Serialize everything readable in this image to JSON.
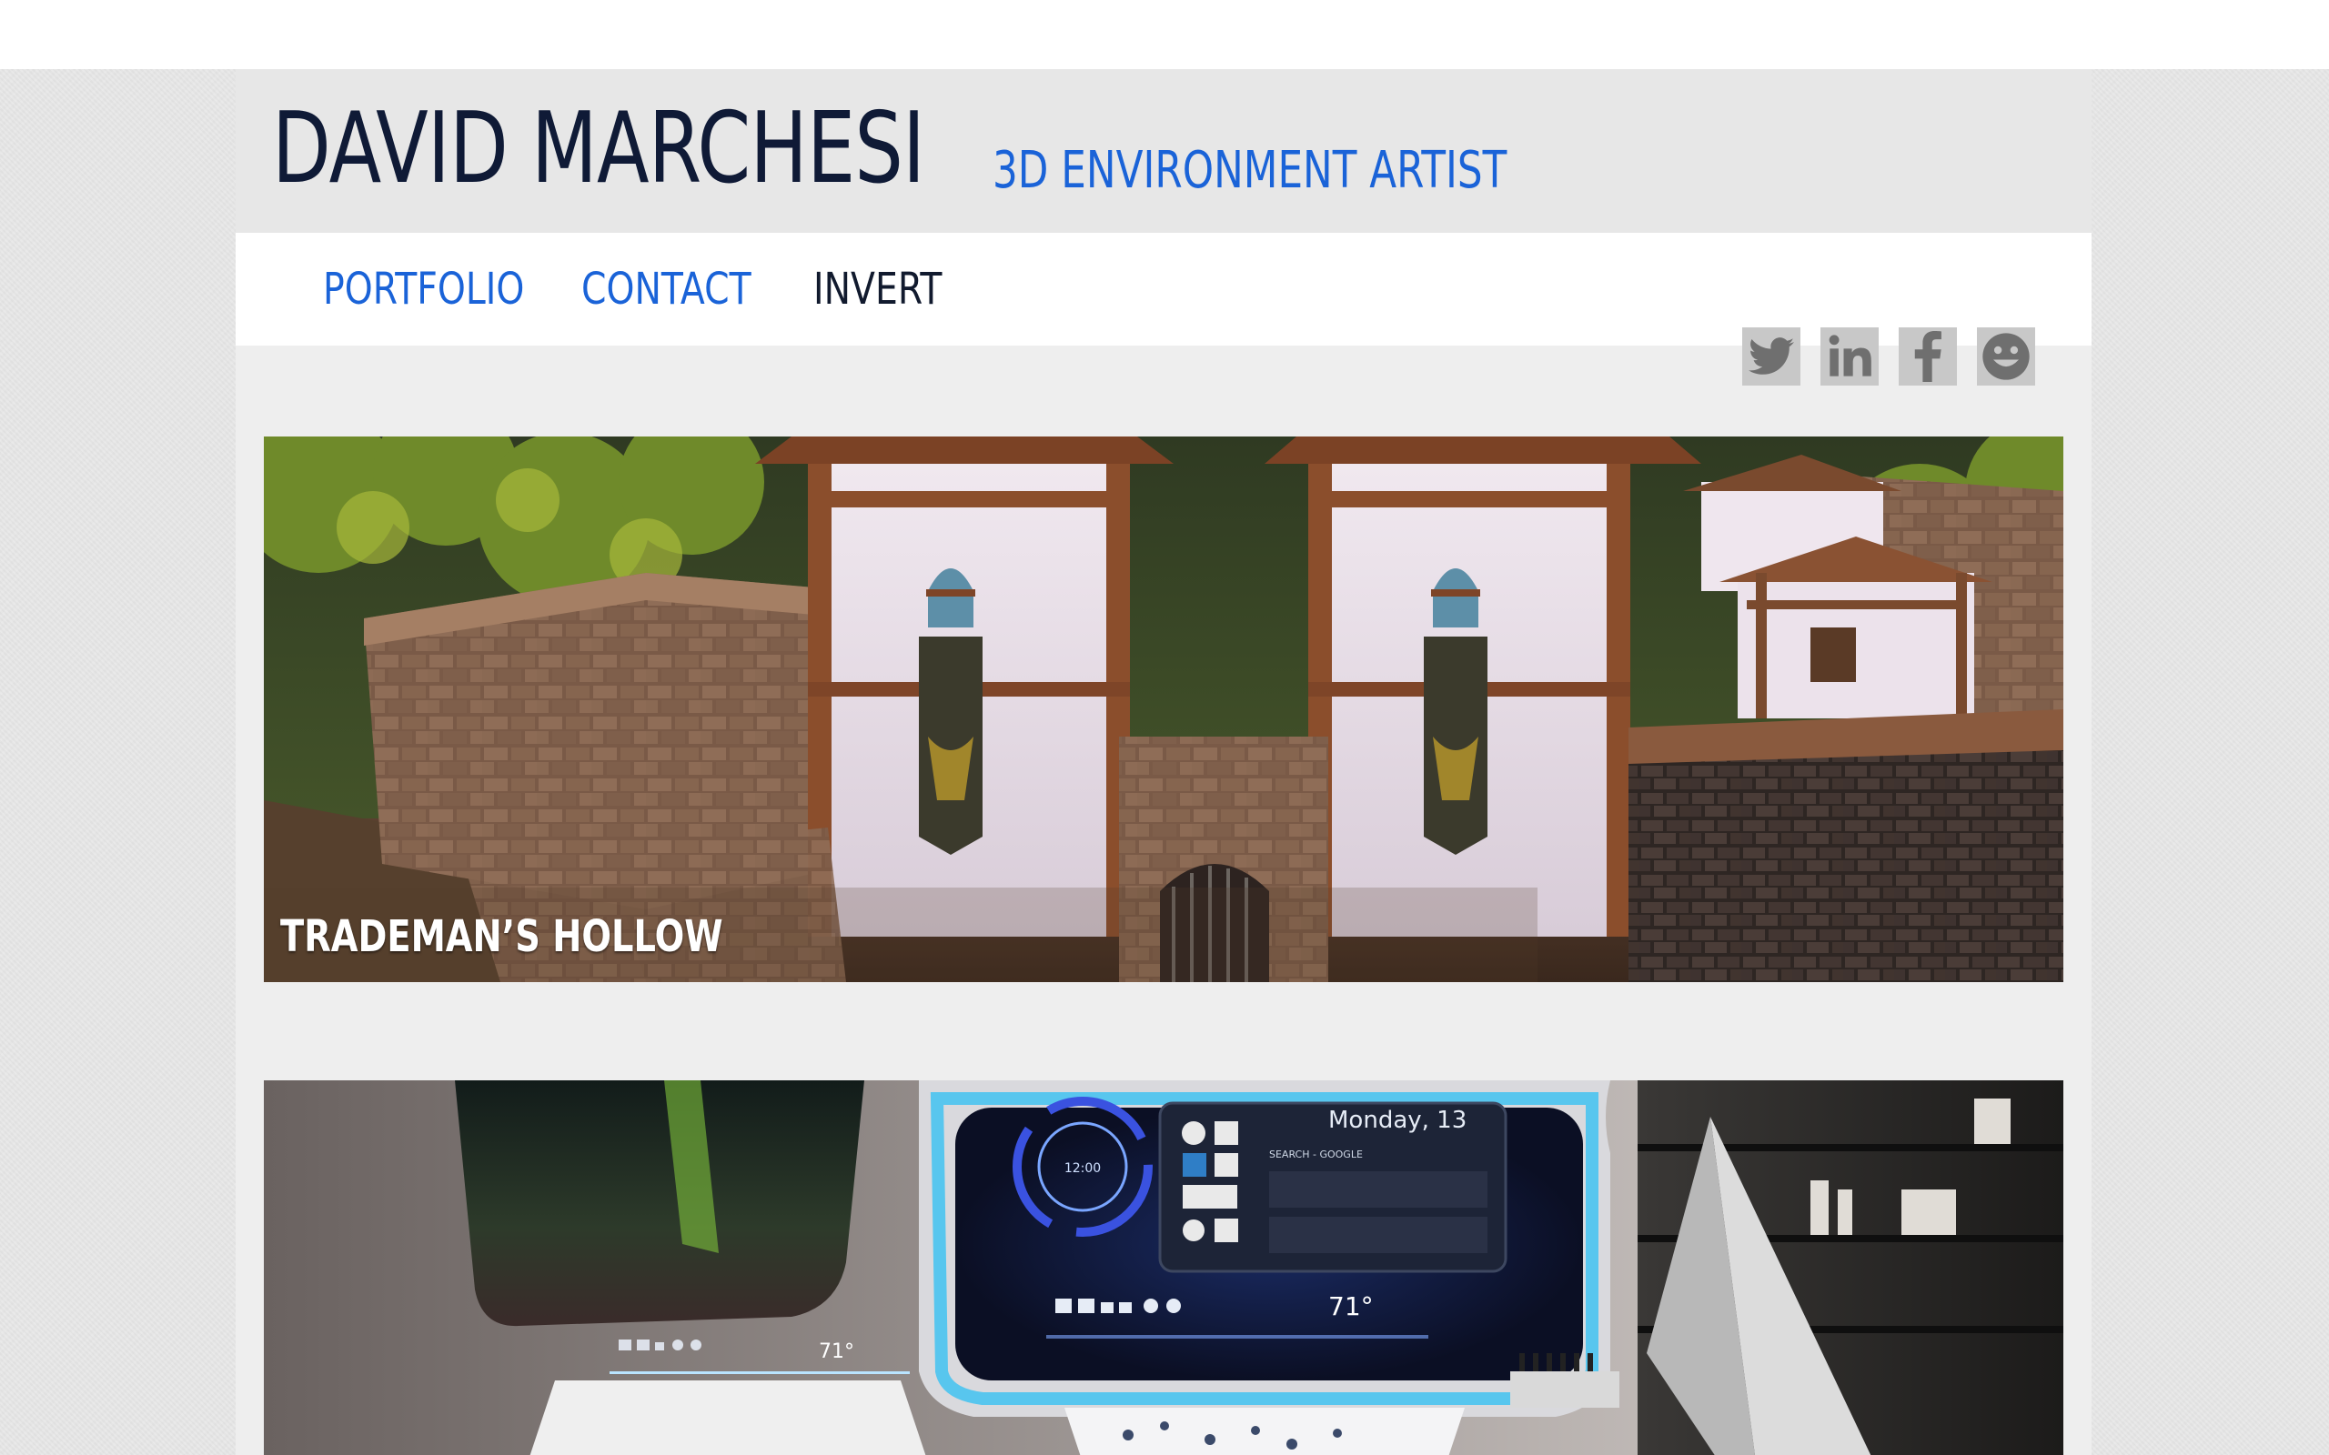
{
  "header": {
    "name": "DAVID MARCHESI",
    "role": "3D ENVIRONMENT ARTIST"
  },
  "nav": {
    "items": [
      {
        "label": "PORTFOLIO"
      },
      {
        "label": "CONTACT"
      },
      {
        "label": "INVERT"
      }
    ]
  },
  "social": [
    {
      "icon": "twitter-icon"
    },
    {
      "icon": "linkedin-icon"
    },
    {
      "icon": "facebook-icon"
    },
    {
      "icon": "steam-icon"
    }
  ],
  "projects": [
    {
      "title": "TRADEMAN’S HOLLOW"
    },
    {
      "title": ""
    }
  ],
  "screen_text": {
    "day": "Monday, 13",
    "search": "SEARCH - GOOGLE",
    "clock": "12:00",
    "temp": "71°"
  },
  "colors": {
    "accent": "#1a63d8",
    "name": "#0f1a36",
    "icon_bg": "#c8c8c8"
  }
}
